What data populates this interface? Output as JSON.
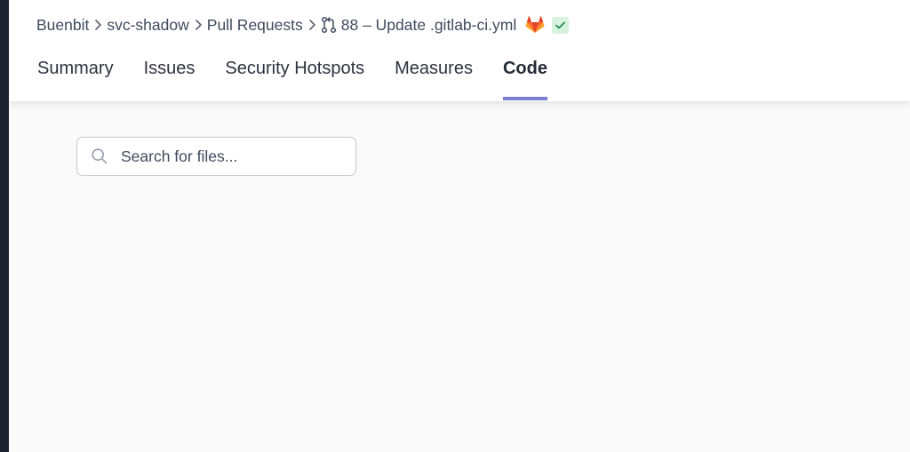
{
  "breadcrumb": {
    "org": "Buenbit",
    "project": "svc-shadow",
    "section": "Pull Requests",
    "pull_request": "88 – Update .gitlab-ci.yml"
  },
  "tabs": [
    {
      "label": "Summary",
      "active": false
    },
    {
      "label": "Issues",
      "active": false
    },
    {
      "label": "Security Hotspots",
      "active": false
    },
    {
      "label": "Measures",
      "active": false
    },
    {
      "label": "Code",
      "active": true
    }
  ],
  "search": {
    "placeholder": "Search for files...",
    "value": ""
  },
  "icons": {
    "pull_request": "git-pull-request-icon",
    "platform": "gitlab-icon",
    "status": "check-icon",
    "search": "search-icon"
  },
  "colors": {
    "active_tab_underline": "#7b7fcf",
    "status_badge_bg": "#d7f2df",
    "status_check": "#1f8a4c",
    "gitlab_orange": "#e24329"
  }
}
